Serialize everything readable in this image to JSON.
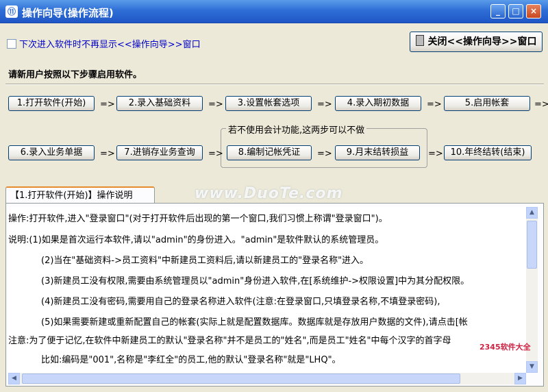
{
  "window": {
    "title": "操作向导(操作流程)",
    "minimize": "_",
    "maximize": "□",
    "close": "×"
  },
  "checkbox_label": "下次进入软件时不再显示<<操作向导>>窗口",
  "close_wizard_label": "关闭<<操作向导>>窗口",
  "instruction": "请新用户按照以下步骤启用软件。",
  "steps": [
    "1.打开软件(开始)",
    "2.录入基础资料",
    "3.设置帐套选项",
    "4.录入期初数据",
    "5.启用帐套",
    "6.录入业务单据",
    "7.进销存业务查询",
    "8.编制记帐凭证",
    "9.月末结转损益",
    "10.年终结转(结束)"
  ],
  "arrow": "=>",
  "group_label": "若不使用会计功能,这两步可以不做",
  "tab_label": "【1.打开软件(开始)】操作说明",
  "watermark": "www.DuoTe.com",
  "corner_logo": "2345软件大全",
  "content_lines": [
    "操作:打开软件,进入\"登录窗口\"(对于打开软件后出现的第一个窗口,我们习惯上称谓\"登录窗口\")。",
    "说明:(1)如果是首次运行本软件,请以\"admin\"的身份进入。\"admin\"是软件默认的系统管理员。",
    "(2)当在\"基础资料->员工资料\"中新建员工资料后,请以新建员工的\"登录名称\"进入。",
    "(3)新建员工没有权限,需要由系统管理员以\"admin\"身份进入软件,在[系统维护->权限设置]中为其分配权限。",
    "(4)新建员工没有密码,需要用自己的登录名称进入软件(注意:在登录窗口,只填登录名称,不填登录密码),",
    "(5)如果需要新建或重新配置自己的帐套(实际上就是配置数据库。数据库就是存放用户数据的文件),请点击[帐",
    "注意:为了便于记忆,在软件中新建员工的默认\"登录名称\"并不是员工的\"姓名\",而是员工\"姓名\"中每个汉字的首字母",
    "比如:编码是\"001\",名称是\"李红全\"的员工,他的默认\"登录名称\"就是\"LHQ\"。"
  ]
}
